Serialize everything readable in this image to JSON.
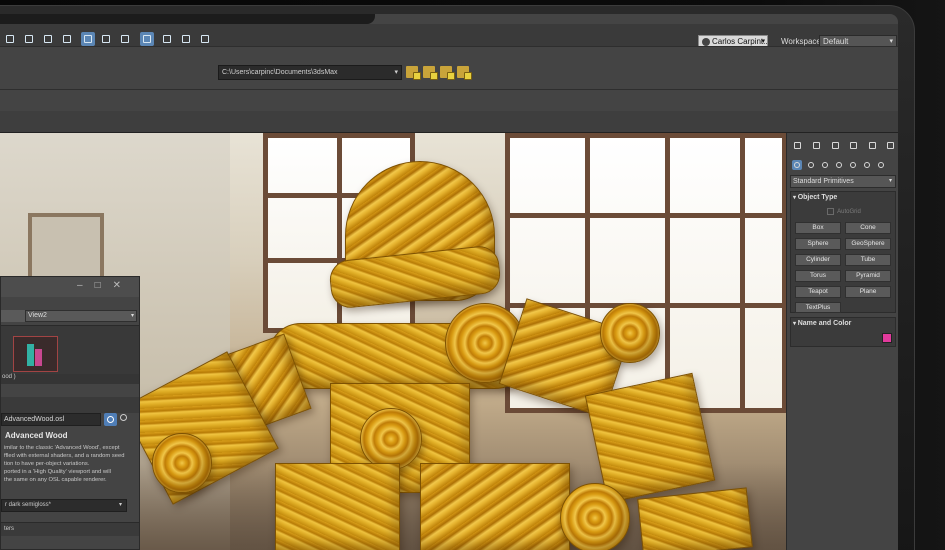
{
  "app": {
    "user_name": "Carlos Carpint...",
    "workspaces_label": "Workspaces:",
    "workspace_value": "Default",
    "project_path": "C:\\Users\\carpinc\\Documents\\3dsMax",
    "toolbar_icons": [
      "align-icon",
      "select-icon",
      "layer-icon",
      "layer-explorer-icon",
      "curve-editor-icon",
      "schematic-icon",
      "material-editor-icon",
      "render-setup-icon",
      "render-frame-icon",
      "render-icon",
      "teapot-icon"
    ],
    "project_icons": [
      "project-folder-icon",
      "project-open-icon",
      "project-new-icon",
      "project-settings-icon"
    ]
  },
  "viewport": {
    "scene": "wooden-robot-render"
  },
  "material_dialog": {
    "view_select": "View2",
    "node_label": "ood )",
    "osl_file": "AdvancedWood.osl",
    "osl_title": "Advanced Wood",
    "description_lines": [
      "imilar to the classic 'Advanced Wood', except",
      "ffled with external shaders, and a random seed",
      "tion to have per-object variations.",
      "ported in a 'High Quality' viewport and will",
      "the same on any OSL capable renderer."
    ],
    "gloss_select": "r dark semigloss*",
    "param_row": "ters"
  },
  "command_panel": {
    "tabs": [
      "create-icon",
      "modify-icon",
      "hierarchy-icon",
      "motion-icon",
      "display-icon",
      "utilities-icon"
    ],
    "subtabs": [
      "geometry-icon",
      "shapes-icon",
      "lights-icon",
      "cameras-icon",
      "helpers-icon",
      "spacewarps-icon",
      "systems-icon"
    ],
    "category": "Standard Primitives",
    "object_type_title": "Object Type",
    "autogrid_label": "AutoGrid",
    "buttons": [
      "Box",
      "Cone",
      "Sphere",
      "GeoSphere",
      "Cylinder",
      "Tube",
      "Torus",
      "Pyramid",
      "Teapot",
      "Plane",
      "TextPlus"
    ],
    "name_color_title": "Name and Color",
    "object_color": "#e23a9c"
  },
  "colors": {
    "accent_blue": "#5b86b5",
    "wood": "#dfad25"
  }
}
